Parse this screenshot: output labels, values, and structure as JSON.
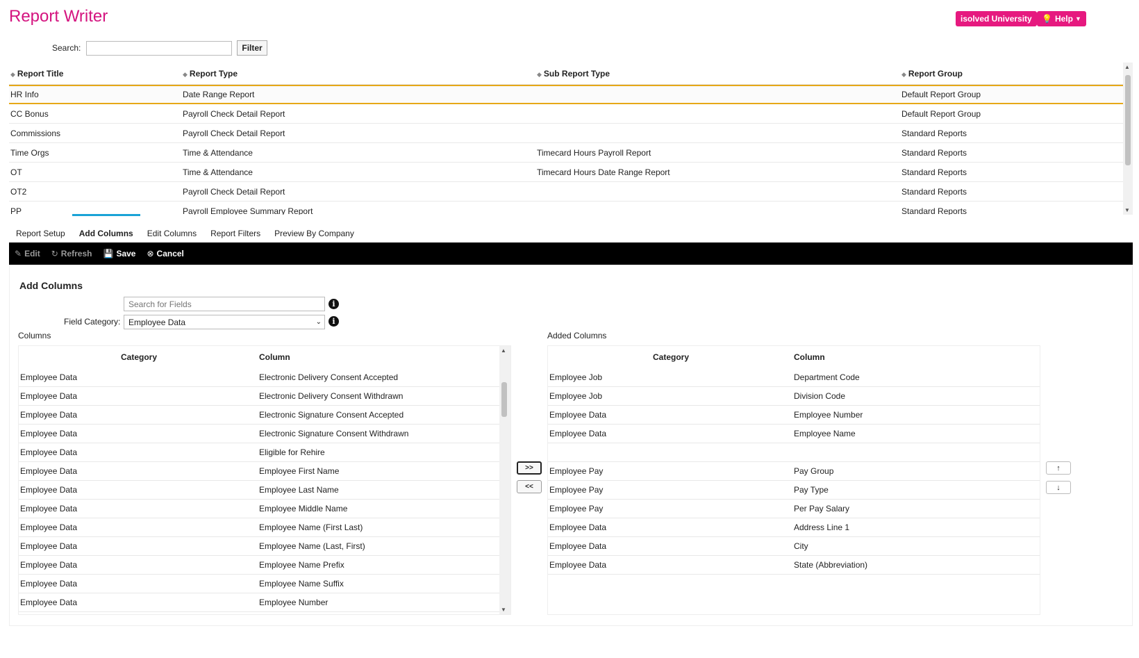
{
  "app": {
    "title": "Report Writer"
  },
  "header": {
    "university_label": "isolved University",
    "help_label": "Help"
  },
  "search": {
    "label": "Search:",
    "value": "",
    "filter_label": "Filter"
  },
  "report_table": {
    "headers": [
      "Report Title",
      "Report Type",
      "Sub Report Type",
      "Report Group"
    ],
    "rows": [
      [
        "HR Info",
        "Date Range Report",
        "",
        "Default Report Group"
      ],
      [
        "CC Bonus",
        "Payroll Check Detail Report",
        "",
        "Default Report Group"
      ],
      [
        "Commissions",
        "Payroll Check Detail Report",
        "",
        "Standard Reports"
      ],
      [
        "Time Orgs",
        "Time & Attendance",
        "Timecard Hours Payroll Report",
        "Standard Reports"
      ],
      [
        "OT",
        "Time & Attendance",
        "Timecard Hours Date Range Report",
        "Standard Reports"
      ],
      [
        "OT2",
        "Payroll Check Detail Report",
        "",
        "Standard Reports"
      ],
      [
        "PP",
        "Payroll Employee Summary Report",
        "",
        "Standard Reports"
      ]
    ]
  },
  "tabs": [
    "Report Setup",
    "Add Columns",
    "Edit Columns",
    "Report Filters",
    "Preview By Company"
  ],
  "toolbar": {
    "edit": "Edit",
    "refresh": "Refresh",
    "save": "Save",
    "cancel": "Cancel"
  },
  "add_columns": {
    "heading": "Add Columns",
    "search_placeholder": "Search for Fields",
    "field_category_label": "Field Category:",
    "field_category_value": "Employee Data",
    "columns_label": "Columns",
    "added_label": "Added Columns",
    "grid_headers": [
      "Category",
      "Column"
    ],
    "available": [
      [
        "Employee Data",
        "Electronic Delivery Consent Accepted"
      ],
      [
        "Employee Data",
        "Electronic Delivery Consent Withdrawn"
      ],
      [
        "Employee Data",
        "Electronic Signature Consent Accepted"
      ],
      [
        "Employee Data",
        "Electronic Signature Consent Withdrawn"
      ],
      [
        "Employee Data",
        "Eligible for Rehire"
      ],
      [
        "Employee Data",
        "Employee First Name"
      ],
      [
        "Employee Data",
        "Employee Last Name"
      ],
      [
        "Employee Data",
        "Employee Middle Name"
      ],
      [
        "Employee Data",
        "Employee Name (First Last)"
      ],
      [
        "Employee Data",
        "Employee Name (Last, First)"
      ],
      [
        "Employee Data",
        "Employee Name Prefix"
      ],
      [
        "Employee Data",
        "Employee Name Suffix"
      ],
      [
        "Employee Data",
        "Employee Number"
      ]
    ],
    "added": [
      [
        "Employee Job",
        "Department Code"
      ],
      [
        "Employee Job",
        "Division Code"
      ],
      [
        "Employee Data",
        "Employee Number"
      ],
      [
        "Employee Data",
        "Employee Name"
      ],
      [
        "",
        ""
      ],
      [
        "Employee Pay",
        "Pay Group"
      ],
      [
        "Employee Pay",
        "Pay Type"
      ],
      [
        "Employee Pay",
        "Per Pay Salary"
      ],
      [
        "Employee Data",
        "Address Line 1"
      ],
      [
        "Employee Data",
        "City"
      ],
      [
        "Employee Data",
        "State (Abbreviation)"
      ]
    ],
    "add_btn": ">>",
    "remove_btn": "<<",
    "up_btn": "↑",
    "down_btn": "↓"
  },
  "colors": {
    "brand": "#d4147f",
    "button_pink": "#e6197f",
    "tab_active": "#1aa3d6",
    "row_select": "#e6a817"
  }
}
